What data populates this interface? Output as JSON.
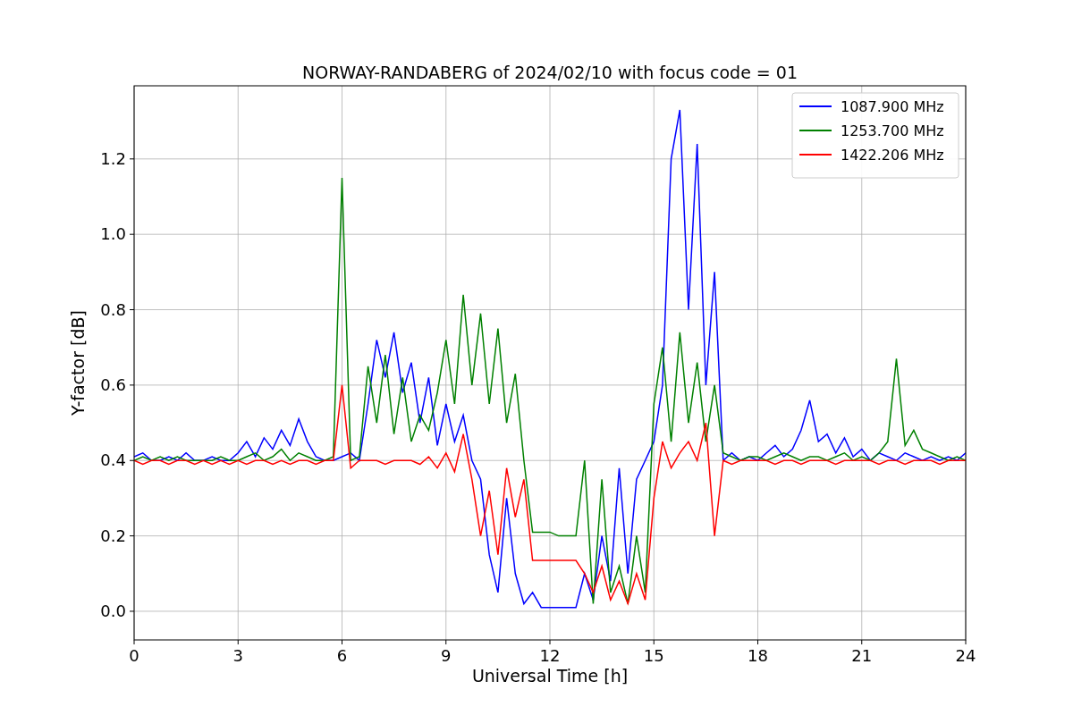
{
  "figure": {
    "chart_data": {
      "type": "line",
      "title": "NORWAY-RANDABERG of 2024/02/10 with focus code = 01",
      "xlabel": "Universal Time [h]",
      "ylabel": "Y-factor [dB]",
      "x": [
        0,
        0.25,
        0.5,
        0.75,
        1,
        1.25,
        1.5,
        1.75,
        2,
        2.25,
        2.5,
        2.75,
        3,
        3.25,
        3.5,
        3.75,
        4,
        4.25,
        4.5,
        4.75,
        5,
        5.25,
        5.5,
        5.75,
        6,
        6.25,
        6.5,
        6.75,
        7,
        7.25,
        7.5,
        7.75,
        8,
        8.25,
        8.5,
        8.75,
        9,
        9.25,
        9.5,
        9.75,
        10,
        10.25,
        10.5,
        10.75,
        11,
        11.25,
        11.5,
        11.75,
        12,
        12.25,
        12.5,
        12.75,
        13,
        13.25,
        13.5,
        13.75,
        14,
        14.25,
        14.5,
        14.75,
        15,
        15.25,
        15.5,
        15.75,
        16,
        16.25,
        16.5,
        16.75,
        17,
        17.25,
        17.5,
        17.75,
        18,
        18.25,
        18.5,
        18.75,
        19,
        19.25,
        19.5,
        19.75,
        20,
        20.25,
        20.5,
        20.75,
        21,
        21.25,
        21.5,
        21.75,
        22,
        22.25,
        22.5,
        22.75,
        23,
        23.25,
        23.5,
        23.75,
        24
      ],
      "series": [
        {
          "name": "1087.900 MHz",
          "color": "#0000ff",
          "values": [
            0.41,
            0.42,
            0.4,
            0.4,
            0.41,
            0.4,
            0.42,
            0.4,
            0.4,
            0.41,
            0.4,
            0.4,
            0.42,
            0.45,
            0.41,
            0.46,
            0.43,
            0.48,
            0.44,
            0.51,
            0.45,
            0.41,
            0.4,
            0.4,
            0.41,
            0.42,
            0.4,
            0.55,
            0.72,
            0.62,
            0.74,
            0.58,
            0.66,
            0.5,
            0.62,
            0.44,
            0.55,
            0.45,
            0.52,
            0.4,
            0.35,
            0.15,
            0.05,
            0.3,
            0.1,
            0.02,
            0.05,
            0.01,
            0.01,
            0.01,
            0.01,
            0.01,
            0.1,
            0.03,
            0.2,
            0.08,
            0.38,
            0.1,
            0.35,
            0.4,
            0.45,
            0.6,
            1.2,
            1.33,
            0.8,
            1.24,
            0.6,
            0.9,
            0.4,
            0.42,
            0.4,
            0.41,
            0.4,
            0.42,
            0.44,
            0.41,
            0.43,
            0.48,
            0.56,
            0.45,
            0.47,
            0.42,
            0.46,
            0.41,
            0.43,
            0.4,
            0.42,
            0.41,
            0.4,
            0.42,
            0.41,
            0.4,
            0.41,
            0.4,
            0.41,
            0.4,
            0.42
          ]
        },
        {
          "name": "1253.700 MHz",
          "color": "#008000",
          "values": [
            0.4,
            0.41,
            0.4,
            0.41,
            0.4,
            0.41,
            0.4,
            0.4,
            0.4,
            0.4,
            0.41,
            0.4,
            0.4,
            0.41,
            0.42,
            0.4,
            0.41,
            0.43,
            0.4,
            0.42,
            0.41,
            0.4,
            0.4,
            0.41,
            1.15,
            0.4,
            0.41,
            0.65,
            0.5,
            0.68,
            0.47,
            0.62,
            0.45,
            0.52,
            0.48,
            0.58,
            0.72,
            0.55,
            0.84,
            0.6,
            0.79,
            0.55,
            0.75,
            0.5,
            0.63,
            0.4,
            0.21,
            0.21,
            0.21,
            0.2,
            0.2,
            0.2,
            0.4,
            0.02,
            0.35,
            0.05,
            0.12,
            0.02,
            0.2,
            0.05,
            0.55,
            0.7,
            0.45,
            0.74,
            0.5,
            0.66,
            0.45,
            0.6,
            0.42,
            0.41,
            0.4,
            0.41,
            0.41,
            0.4,
            0.41,
            0.42,
            0.41,
            0.4,
            0.41,
            0.41,
            0.4,
            0.41,
            0.42,
            0.4,
            0.41,
            0.4,
            0.42,
            0.45,
            0.67,
            0.44,
            0.48,
            0.43,
            0.42,
            0.41,
            0.4,
            0.41,
            0.4
          ]
        },
        {
          "name": "1422.206 MHz",
          "color": "#ff0000",
          "values": [
            0.4,
            0.39,
            0.4,
            0.4,
            0.39,
            0.4,
            0.4,
            0.39,
            0.4,
            0.39,
            0.4,
            0.39,
            0.4,
            0.39,
            0.4,
            0.4,
            0.39,
            0.4,
            0.39,
            0.4,
            0.4,
            0.39,
            0.4,
            0.4,
            0.6,
            0.38,
            0.4,
            0.4,
            0.4,
            0.39,
            0.4,
            0.4,
            0.4,
            0.39,
            0.41,
            0.38,
            0.42,
            0.37,
            0.47,
            0.35,
            0.2,
            0.32,
            0.15,
            0.38,
            0.25,
            0.35,
            0.135,
            0.135,
            0.135,
            0.135,
            0.135,
            0.135,
            0.1,
            0.05,
            0.12,
            0.03,
            0.08,
            0.02,
            0.1,
            0.03,
            0.3,
            0.45,
            0.38,
            0.42,
            0.45,
            0.4,
            0.5,
            0.2,
            0.4,
            0.39,
            0.4,
            0.4,
            0.4,
            0.4,
            0.39,
            0.4,
            0.4,
            0.39,
            0.4,
            0.4,
            0.4,
            0.39,
            0.4,
            0.4,
            0.4,
            0.4,
            0.39,
            0.4,
            0.4,
            0.39,
            0.4,
            0.4,
            0.4,
            0.39,
            0.4,
            0.4,
            0.4
          ]
        }
      ],
      "grid": true,
      "legend": true,
      "xlim": [
        0,
        24
      ],
      "ylim": [
        -0.076,
        1.394
      ],
      "xticks": [
        0,
        3,
        6,
        9,
        12,
        15,
        18,
        21,
        24
      ],
      "yticks": [
        {
          "value": 0,
          "label": "0.0"
        },
        {
          "value": 0.2,
          "label": "0.2"
        },
        {
          "value": 0.4,
          "label": "0.4"
        },
        {
          "value": 0.6,
          "label": "0.6"
        },
        {
          "value": 0.8,
          "label": "0.8"
        },
        {
          "value": 1.0,
          "label": "1.0"
        },
        {
          "value": 1.2,
          "label": "1.2"
        }
      ]
    }
  }
}
